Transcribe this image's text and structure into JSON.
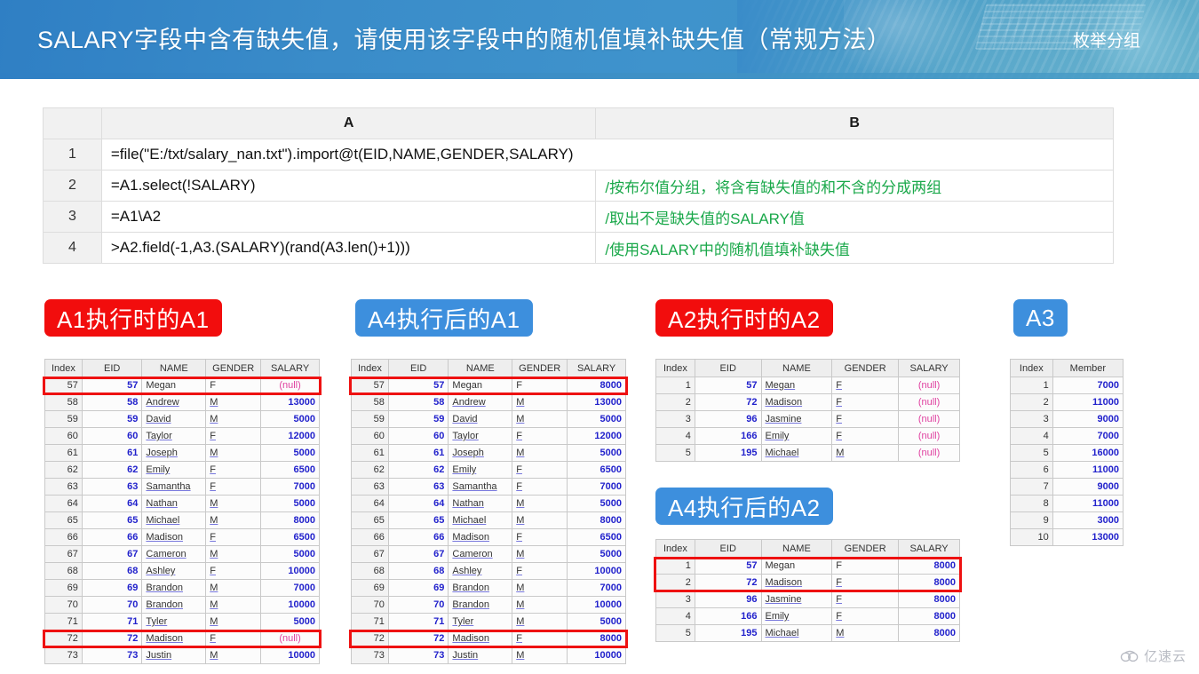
{
  "banner": {
    "title": "SALARY字段中含有缺失值，请使用该字段中的随机值填补缺失值（常规方法）",
    "subtitle": "枚举分组",
    "bg_color": "#3a8cc9"
  },
  "code_grid": {
    "col_headers": [
      "A",
      "B"
    ],
    "rows": [
      {
        "no": "1",
        "a": "=file(\"E:/txt/salary_nan.txt\").import@t(EID,NAME,GENDER,SALARY)",
        "b": ""
      },
      {
        "no": "2",
        "a": "=A1.select(!SALARY)",
        "b": "/按布尔值分组，将含有缺失值的和不含的分成两组"
      },
      {
        "no": "3",
        "a": "=A1\\A2",
        "b": "/取出不是缺失值的SALARY值"
      },
      {
        "no": "4",
        "a": ">A2.field(-1,A3.(SALARY)(rand(A3.len()+1)))",
        "b": "/使用SALARY中的随机值填补缺失值"
      }
    ]
  },
  "badges": {
    "a1_before": "A1执行时的A1",
    "a1_after": "A4执行后的A1",
    "a2_before": "A2执行时的A2",
    "a2_after": "A4执行后的A2",
    "a3": "A3"
  },
  "colors": {
    "badge_red": "#f20d0d",
    "badge_blue": "#3d8fdd",
    "highlight_red": "#ee1111",
    "null_text": "#e040a0",
    "number_text": "#2222cc",
    "note_green": "#1aa84a"
  },
  "table_a1_before": {
    "columns": [
      "Index",
      "EID",
      "NAME",
      "GENDER",
      "SALARY"
    ],
    "rows": [
      [
        "57",
        "57",
        "Megan",
        "F",
        "(null)"
      ],
      [
        "58",
        "58",
        "Andrew",
        "M",
        "13000"
      ],
      [
        "59",
        "59",
        "David",
        "M",
        "5000"
      ],
      [
        "60",
        "60",
        "Taylor",
        "F",
        "12000"
      ],
      [
        "61",
        "61",
        "Joseph",
        "M",
        "5000"
      ],
      [
        "62",
        "62",
        "Emily",
        "F",
        "6500"
      ],
      [
        "63",
        "63",
        "Samantha",
        "F",
        "7000"
      ],
      [
        "64",
        "64",
        "Nathan",
        "M",
        "5000"
      ],
      [
        "65",
        "65",
        "Michael",
        "M",
        "8000"
      ],
      [
        "66",
        "66",
        "Madison",
        "F",
        "6500"
      ],
      [
        "67",
        "67",
        "Cameron",
        "M",
        "5000"
      ],
      [
        "68",
        "68",
        "Ashley",
        "F",
        "10000"
      ],
      [
        "69",
        "69",
        "Brandon",
        "M",
        "7000"
      ],
      [
        "70",
        "70",
        "Brandon",
        "M",
        "10000"
      ],
      [
        "71",
        "71",
        "Tyler",
        "M",
        "5000"
      ],
      [
        "72",
        "72",
        "Madison",
        "F",
        "(null)"
      ],
      [
        "73",
        "73",
        "Justin",
        "M",
        "10000"
      ]
    ],
    "highlighted_rows": [
      0,
      15
    ]
  },
  "table_a1_after": {
    "columns": [
      "Index",
      "EID",
      "NAME",
      "GENDER",
      "SALARY"
    ],
    "rows": [
      [
        "57",
        "57",
        "Megan",
        "F",
        "8000"
      ],
      [
        "58",
        "58",
        "Andrew",
        "M",
        "13000"
      ],
      [
        "59",
        "59",
        "David",
        "M",
        "5000"
      ],
      [
        "60",
        "60",
        "Taylor",
        "F",
        "12000"
      ],
      [
        "61",
        "61",
        "Joseph",
        "M",
        "5000"
      ],
      [
        "62",
        "62",
        "Emily",
        "F",
        "6500"
      ],
      [
        "63",
        "63",
        "Samantha",
        "F",
        "7000"
      ],
      [
        "64",
        "64",
        "Nathan",
        "M",
        "5000"
      ],
      [
        "65",
        "65",
        "Michael",
        "M",
        "8000"
      ],
      [
        "66",
        "66",
        "Madison",
        "F",
        "6500"
      ],
      [
        "67",
        "67",
        "Cameron",
        "M",
        "5000"
      ],
      [
        "68",
        "68",
        "Ashley",
        "F",
        "10000"
      ],
      [
        "69",
        "69",
        "Brandon",
        "M",
        "7000"
      ],
      [
        "70",
        "70",
        "Brandon",
        "M",
        "10000"
      ],
      [
        "71",
        "71",
        "Tyler",
        "M",
        "5000"
      ],
      [
        "72",
        "72",
        "Madison",
        "F",
        "8000"
      ],
      [
        "73",
        "73",
        "Justin",
        "M",
        "10000"
      ]
    ],
    "highlighted_rows": [
      0,
      15
    ]
  },
  "table_a2_before": {
    "columns": [
      "Index",
      "EID",
      "NAME",
      "GENDER",
      "SALARY"
    ],
    "rows": [
      [
        "1",
        "57",
        "Megan",
        "F",
        "(null)"
      ],
      [
        "2",
        "72",
        "Madison",
        "F",
        "(null)"
      ],
      [
        "3",
        "96",
        "Jasmine",
        "F",
        "(null)"
      ],
      [
        "4",
        "166",
        "Emily",
        "F",
        "(null)"
      ],
      [
        "5",
        "195",
        "Michael",
        "M",
        "(null)"
      ]
    ],
    "highlighted_rows": []
  },
  "table_a2_after": {
    "columns": [
      "Index",
      "EID",
      "NAME",
      "GENDER",
      "SALARY"
    ],
    "rows": [
      [
        "1",
        "57",
        "Megan",
        "F",
        "8000"
      ],
      [
        "2",
        "72",
        "Madison",
        "F",
        "8000"
      ],
      [
        "3",
        "96",
        "Jasmine",
        "F",
        "8000"
      ],
      [
        "4",
        "166",
        "Emily",
        "F",
        "8000"
      ],
      [
        "5",
        "195",
        "Michael",
        "M",
        "8000"
      ]
    ],
    "highlighted_rows": [
      0,
      1
    ]
  },
  "table_a3": {
    "columns": [
      "Index",
      "Member"
    ],
    "rows": [
      [
        "1",
        "7000"
      ],
      [
        "2",
        "11000"
      ],
      [
        "3",
        "9000"
      ],
      [
        "4",
        "7000"
      ],
      [
        "5",
        "16000"
      ],
      [
        "6",
        "11000"
      ],
      [
        "7",
        "9000"
      ],
      [
        "8",
        "11000"
      ],
      [
        "9",
        "3000"
      ],
      [
        "10",
        "13000"
      ]
    ]
  },
  "watermark": {
    "text": "亿速云",
    "icon": "cloud-icon"
  }
}
